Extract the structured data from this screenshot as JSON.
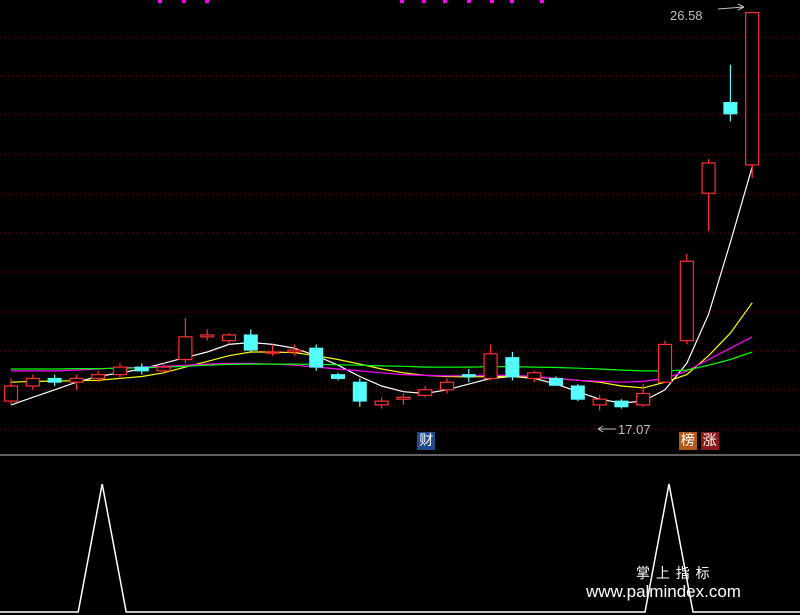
{
  "chart_data": {
    "type": "candlestick",
    "price_range": [
      15.8,
      26.7
    ],
    "grid": "dotted-horizontal",
    "candles": [
      {
        "o": 16.3,
        "h": 16.9,
        "l": 16.2,
        "c": 16.7
      },
      {
        "o": 16.7,
        "h": 17.0,
        "l": 16.6,
        "c": 16.9
      },
      {
        "o": 16.9,
        "h": 17.0,
        "l": 16.7,
        "c": 16.8
      },
      {
        "o": 16.8,
        "h": 17.0,
        "l": 16.6,
        "c": 16.9
      },
      {
        "o": 16.9,
        "h": 17.1,
        "l": 16.8,
        "c": 17.0
      },
      {
        "o": 17.0,
        "h": 17.3,
        "l": 16.9,
        "c": 17.2
      },
      {
        "o": 17.2,
        "h": 17.3,
        "l": 17.0,
        "c": 17.1
      },
      {
        "o": 17.1,
        "h": 17.3,
        "l": 17.0,
        "c": 17.2
      },
      {
        "o": 17.4,
        "h": 18.5,
        "l": 17.3,
        "c": 18.0
      },
      {
        "o": 18.0,
        "h": 18.2,
        "l": 17.9,
        "c": 18.05
      },
      {
        "o": 17.9,
        "h": 18.1,
        "l": 17.8,
        "c": 18.05
      },
      {
        "o": 18.05,
        "h": 18.2,
        "l": 17.6,
        "c": 17.65
      },
      {
        "o": 17.6,
        "h": 17.8,
        "l": 17.5,
        "c": 17.6
      },
      {
        "o": 17.6,
        "h": 17.8,
        "l": 17.5,
        "c": 17.65
      },
      {
        "o": 17.7,
        "h": 17.8,
        "l": 17.1,
        "c": 17.2
      },
      {
        "o": 17.0,
        "h": 17.05,
        "l": 16.85,
        "c": 16.9
      },
      {
        "o": 16.8,
        "h": 16.9,
        "l": 16.15,
        "c": 16.3
      },
      {
        "o": 16.2,
        "h": 16.4,
        "l": 16.1,
        "c": 16.3
      },
      {
        "o": 16.35,
        "h": 16.5,
        "l": 16.2,
        "c": 16.4
      },
      {
        "o": 16.45,
        "h": 16.7,
        "l": 16.4,
        "c": 16.6
      },
      {
        "o": 16.6,
        "h": 16.9,
        "l": 16.5,
        "c": 16.8
      },
      {
        "o": 17.0,
        "h": 17.15,
        "l": 16.8,
        "c": 16.95
      },
      {
        "o": 16.9,
        "h": 17.8,
        "l": 16.85,
        "c": 17.55
      },
      {
        "o": 17.45,
        "h": 17.6,
        "l": 16.85,
        "c": 16.95
      },
      {
        "o": 16.9,
        "h": 17.1,
        "l": 16.8,
        "c": 17.05
      },
      {
        "o": 16.9,
        "h": 16.95,
        "l": 16.7,
        "c": 16.72
      },
      {
        "o": 16.7,
        "h": 16.75,
        "l": 16.3,
        "c": 16.35
      },
      {
        "o": 16.2,
        "h": 16.45,
        "l": 16.05,
        "c": 16.35
      },
      {
        "o": 16.3,
        "h": 16.35,
        "l": 16.1,
        "c": 16.15
      },
      {
        "o": 16.2,
        "h": 16.75,
        "l": 16.15,
        "c": 16.5
      },
      {
        "o": 16.8,
        "h": 17.9,
        "l": 16.8,
        "c": 17.8
      },
      {
        "o": 17.9,
        "h": 20.2,
        "l": 17.8,
        "c": 20.0
      },
      {
        "o": 21.8,
        "h": 22.7,
        "l": 20.8,
        "c": 22.6
      },
      {
        "o": 24.2,
        "h": 25.2,
        "l": 23.7,
        "c": 23.9
      },
      {
        "o": 22.55,
        "h": 26.58,
        "l": 22.2,
        "c": 26.58
      }
    ],
    "ma_lines": [
      {
        "color": "#ffffff",
        "values": [
          16.2,
          16.4,
          16.6,
          16.8,
          16.95,
          17.05,
          17.15,
          17.3,
          17.45,
          17.6,
          17.8,
          17.85,
          17.8,
          17.7,
          17.5,
          17.25,
          16.95,
          16.7,
          16.55,
          16.5,
          16.6,
          16.75,
          16.9,
          16.95,
          16.9,
          16.75,
          16.55,
          16.35,
          16.25,
          16.3,
          16.6,
          17.3,
          18.6,
          20.5,
          22.5
        ]
      },
      {
        "color": "#ffff00",
        "values": [
          16.8,
          16.82,
          16.83,
          16.84,
          16.85,
          16.9,
          16.95,
          17.05,
          17.2,
          17.35,
          17.5,
          17.6,
          17.6,
          17.58,
          17.5,
          17.4,
          17.28,
          17.15,
          17.05,
          16.98,
          16.95,
          16.94,
          16.95,
          16.95,
          16.93,
          16.9,
          16.85,
          16.8,
          16.7,
          16.65,
          16.8,
          17.0,
          17.5,
          18.1,
          18.9
        ]
      },
      {
        "color": "#ff00ff",
        "values": [
          17.1,
          17.1,
          17.1,
          17.12,
          17.15,
          17.18,
          17.2,
          17.22,
          17.25,
          17.28,
          17.3,
          17.3,
          17.28,
          17.25,
          17.2,
          17.15,
          17.1,
          17.05,
          17.0,
          16.98,
          16.97,
          16.97,
          16.98,
          16.98,
          16.95,
          16.9,
          16.85,
          16.82,
          16.8,
          16.82,
          16.9,
          17.1,
          17.4,
          17.7,
          18.0
        ]
      },
      {
        "color": "#00ff00",
        "values": [
          17.15,
          17.15,
          17.15,
          17.16,
          17.16,
          17.17,
          17.18,
          17.2,
          17.22,
          17.25,
          17.27,
          17.28,
          17.28,
          17.28,
          17.27,
          17.26,
          17.25,
          17.23,
          17.22,
          17.2,
          17.2,
          17.2,
          17.21,
          17.21,
          17.2,
          17.19,
          17.17,
          17.15,
          17.12,
          17.1,
          17.1,
          17.12,
          17.25,
          17.4,
          17.6
        ]
      }
    ],
    "annotations": {
      "high_label": "26.58",
      "low_label": "17.07",
      "tags": [
        {
          "text": "财",
          "index": 19,
          "bg": "#1f4b8e",
          "color": "#ffffff"
        },
        {
          "text": "榜",
          "index": 31,
          "bg": "#b25a1c",
          "color": "#ffffff"
        },
        {
          "text": "涨",
          "index": 32,
          "bg": "#8b1a1a",
          "color": "#ffffff"
        }
      ]
    },
    "indicator": {
      "color": "#ffffff",
      "peaks": [
        4,
        30
      ]
    }
  },
  "watermark": {
    "title": "掌 上 指 标",
    "url": "www.palmindex.com"
  },
  "colors": {
    "up": "#ff3030",
    "down": "#54ffff",
    "grid": "#7a0000",
    "separator": "#c0c0c0",
    "top_marks": "#ff00ff"
  }
}
